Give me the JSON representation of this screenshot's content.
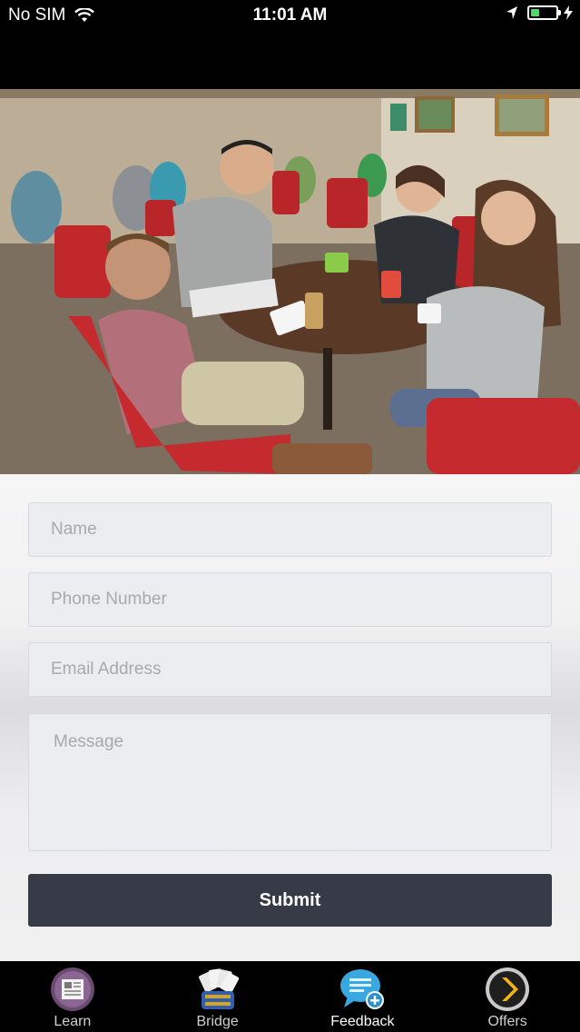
{
  "status_bar": {
    "carrier": "No SIM",
    "time": "11:01 AM",
    "battery_level": 0.35,
    "battery_color": "#4cd964"
  },
  "hero": {
    "description_icon": "photo"
  },
  "form": {
    "name_placeholder": "Name",
    "phone_placeholder": "Phone Number",
    "email_placeholder": "Email Address",
    "message_placeholder": "Message",
    "submit_label": "Submit",
    "submit_color": "#363b47"
  },
  "tab_bar": {
    "items": [
      {
        "label": "Learn",
        "icon": "newspaper-icon",
        "active": false
      },
      {
        "label": "Bridge",
        "icon": "playing-cards-icon",
        "active": false
      },
      {
        "label": "Feedback",
        "icon": "chat-bubble-add-icon",
        "active": true
      },
      {
        "label": "Offers",
        "icon": "chevron-right-icon",
        "active": false
      }
    ]
  }
}
